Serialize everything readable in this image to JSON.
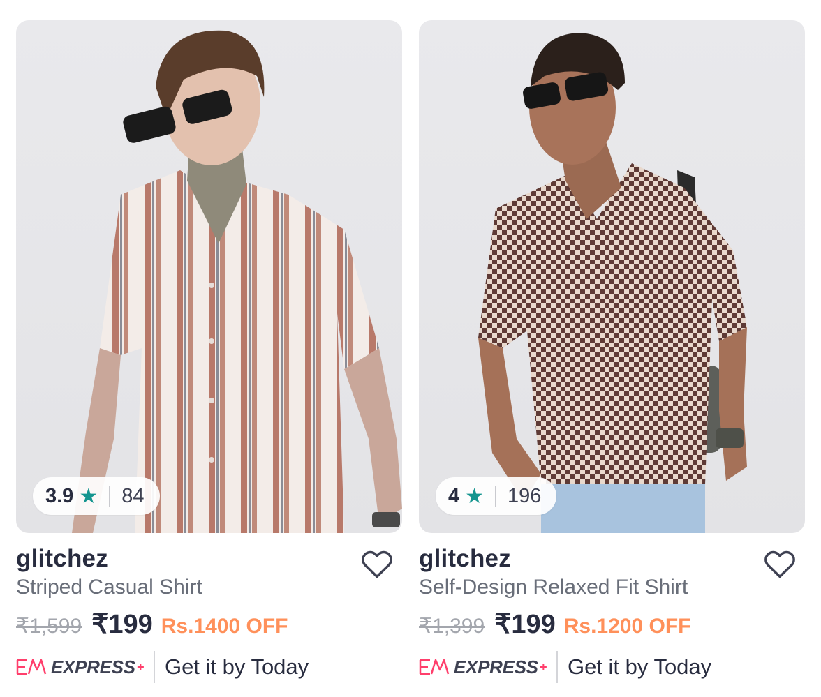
{
  "products": [
    {
      "image_alt": "Man wearing striped casual shirt and sunglasses",
      "rating": "3.9",
      "rating_count": "84",
      "brand": "glitchez",
      "name": "Striped Casual Shirt",
      "mrp": "₹1,599",
      "price": "₹199",
      "discount": "Rs.1400 OFF",
      "express_label": "EXPRESS",
      "express_plus": "+",
      "delivery": "Get it by Today"
    },
    {
      "image_alt": "Man wearing self-design relaxed fit shirt with sunglasses and bag",
      "rating": "4",
      "rating_count": "196",
      "brand": "glitchez",
      "name": "Self-Design Relaxed Fit Shirt",
      "mrp": "₹1,399",
      "price": "₹199",
      "discount": "Rs.1200 OFF",
      "express_label": "EXPRESS",
      "express_plus": "+",
      "delivery": "Get it by Today"
    }
  ],
  "icons": {
    "star": "★",
    "wishlist": "heart-outline-icon",
    "express": "express-logo-icon"
  },
  "colors": {
    "star": "#14958f",
    "discount": "#ff905a",
    "express_accent": "#ff3f6c",
    "text_primary": "#282c3f",
    "text_secondary": "#696e79"
  }
}
